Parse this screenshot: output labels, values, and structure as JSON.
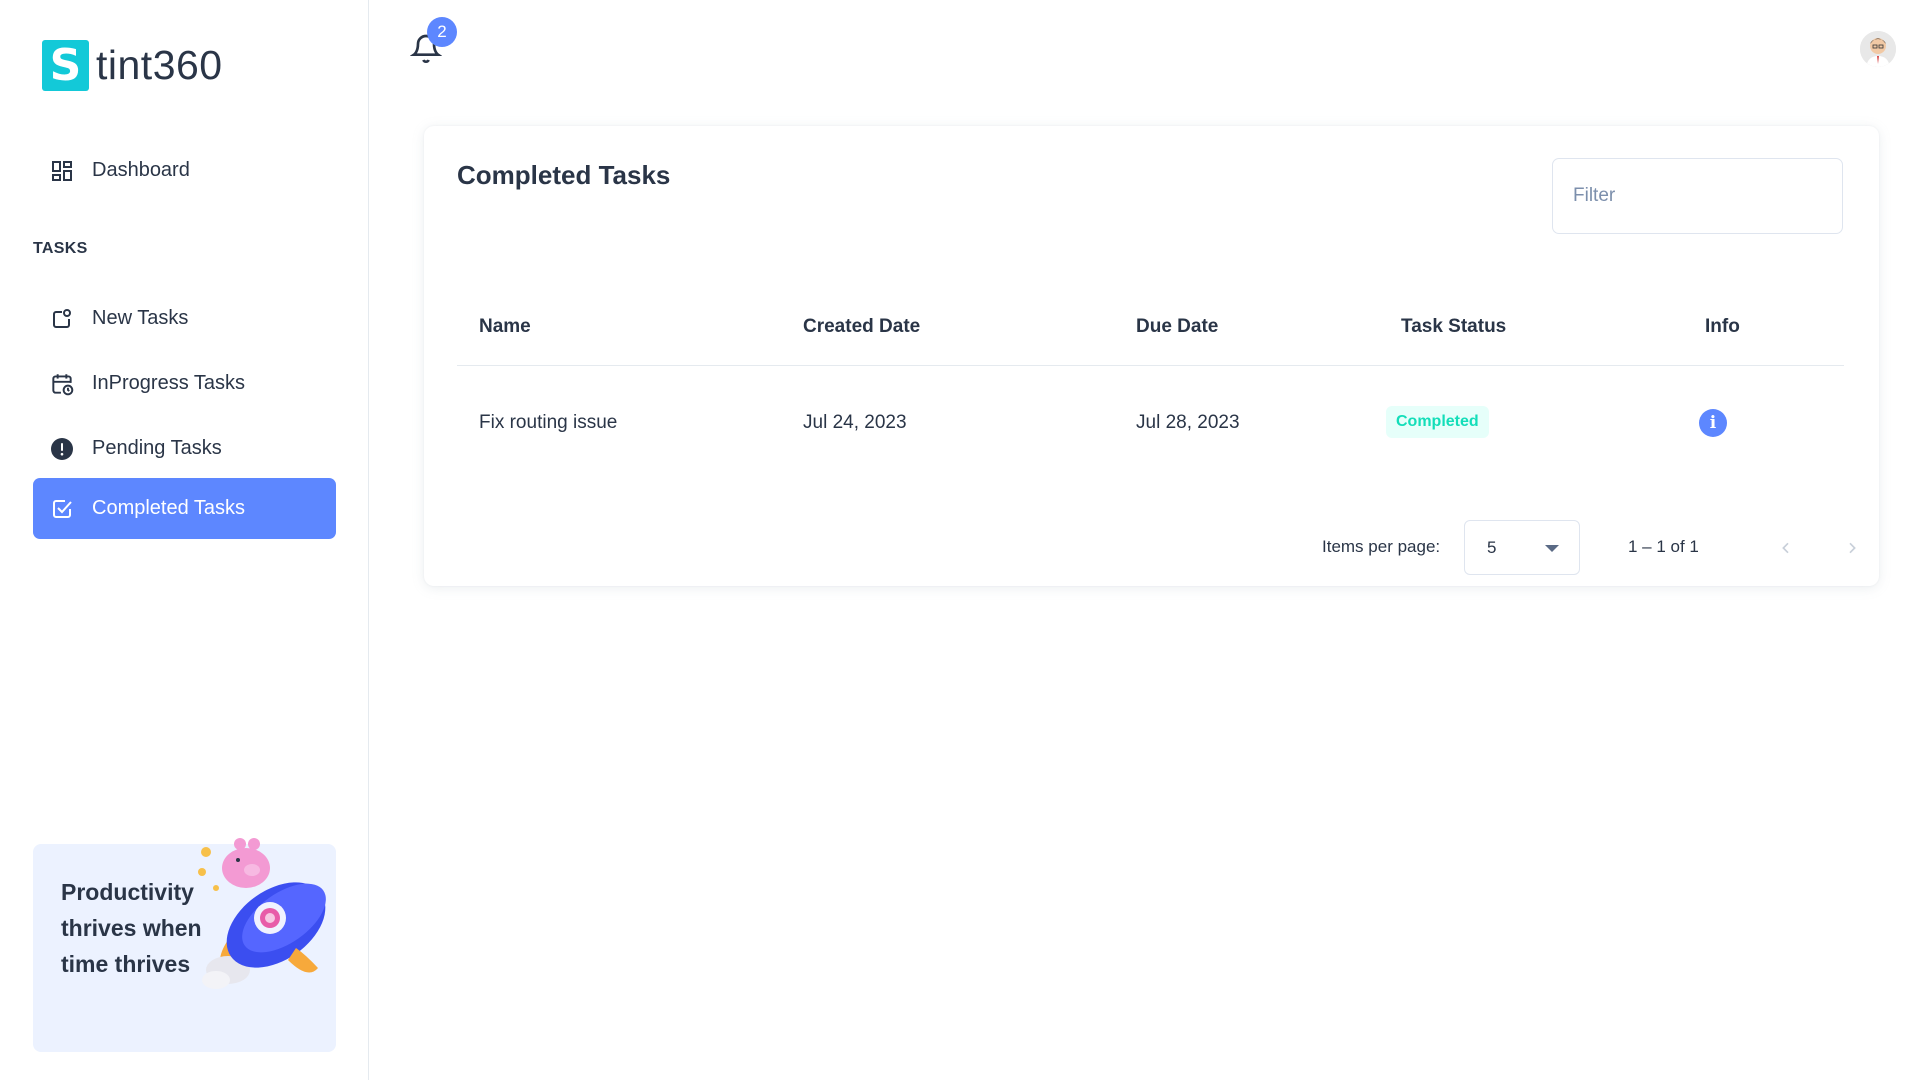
{
  "brand": {
    "name": "tint360",
    "mark": "S",
    "color": "#13c9d8"
  },
  "sidebar": {
    "dashboard": {
      "label": "Dashboard",
      "icon": "dashboard-icon"
    },
    "section_label": "TASKS",
    "items": [
      {
        "label": "New Tasks",
        "icon": "new-task-icon",
        "active": false
      },
      {
        "label": "InProgress Tasks",
        "icon": "calendar-clock-icon",
        "active": false
      },
      {
        "label": "Pending Tasks",
        "icon": "exclamation-circle-icon",
        "active": false
      },
      {
        "label": "Completed Tasks",
        "icon": "checkbox-checked-icon",
        "active": true
      }
    ],
    "promo_text": "Productivity thrives when time thrives"
  },
  "header": {
    "notification_count": "2",
    "notification_icon": "bell-icon",
    "avatar_icon": "user-avatar-icon"
  },
  "card": {
    "title": "Completed Tasks",
    "filter_placeholder": "Filter",
    "table": {
      "columns": [
        "Name",
        "Created Date",
        "Due Date",
        "Task Status",
        "Info"
      ],
      "rows": [
        {
          "name": "Fix routing issue",
          "created": "Jul 24, 2023",
          "due": "Jul 28, 2023",
          "status": "Completed"
        }
      ]
    },
    "pagination": {
      "items_per_page_label": "Items per page:",
      "items_per_page": "5",
      "range": "1 – 1 of 1"
    }
  },
  "colors": {
    "primary": "#5d87ff",
    "success": "#13deb9",
    "success_bg": "#e6fffa",
    "text": "#2a3547"
  }
}
